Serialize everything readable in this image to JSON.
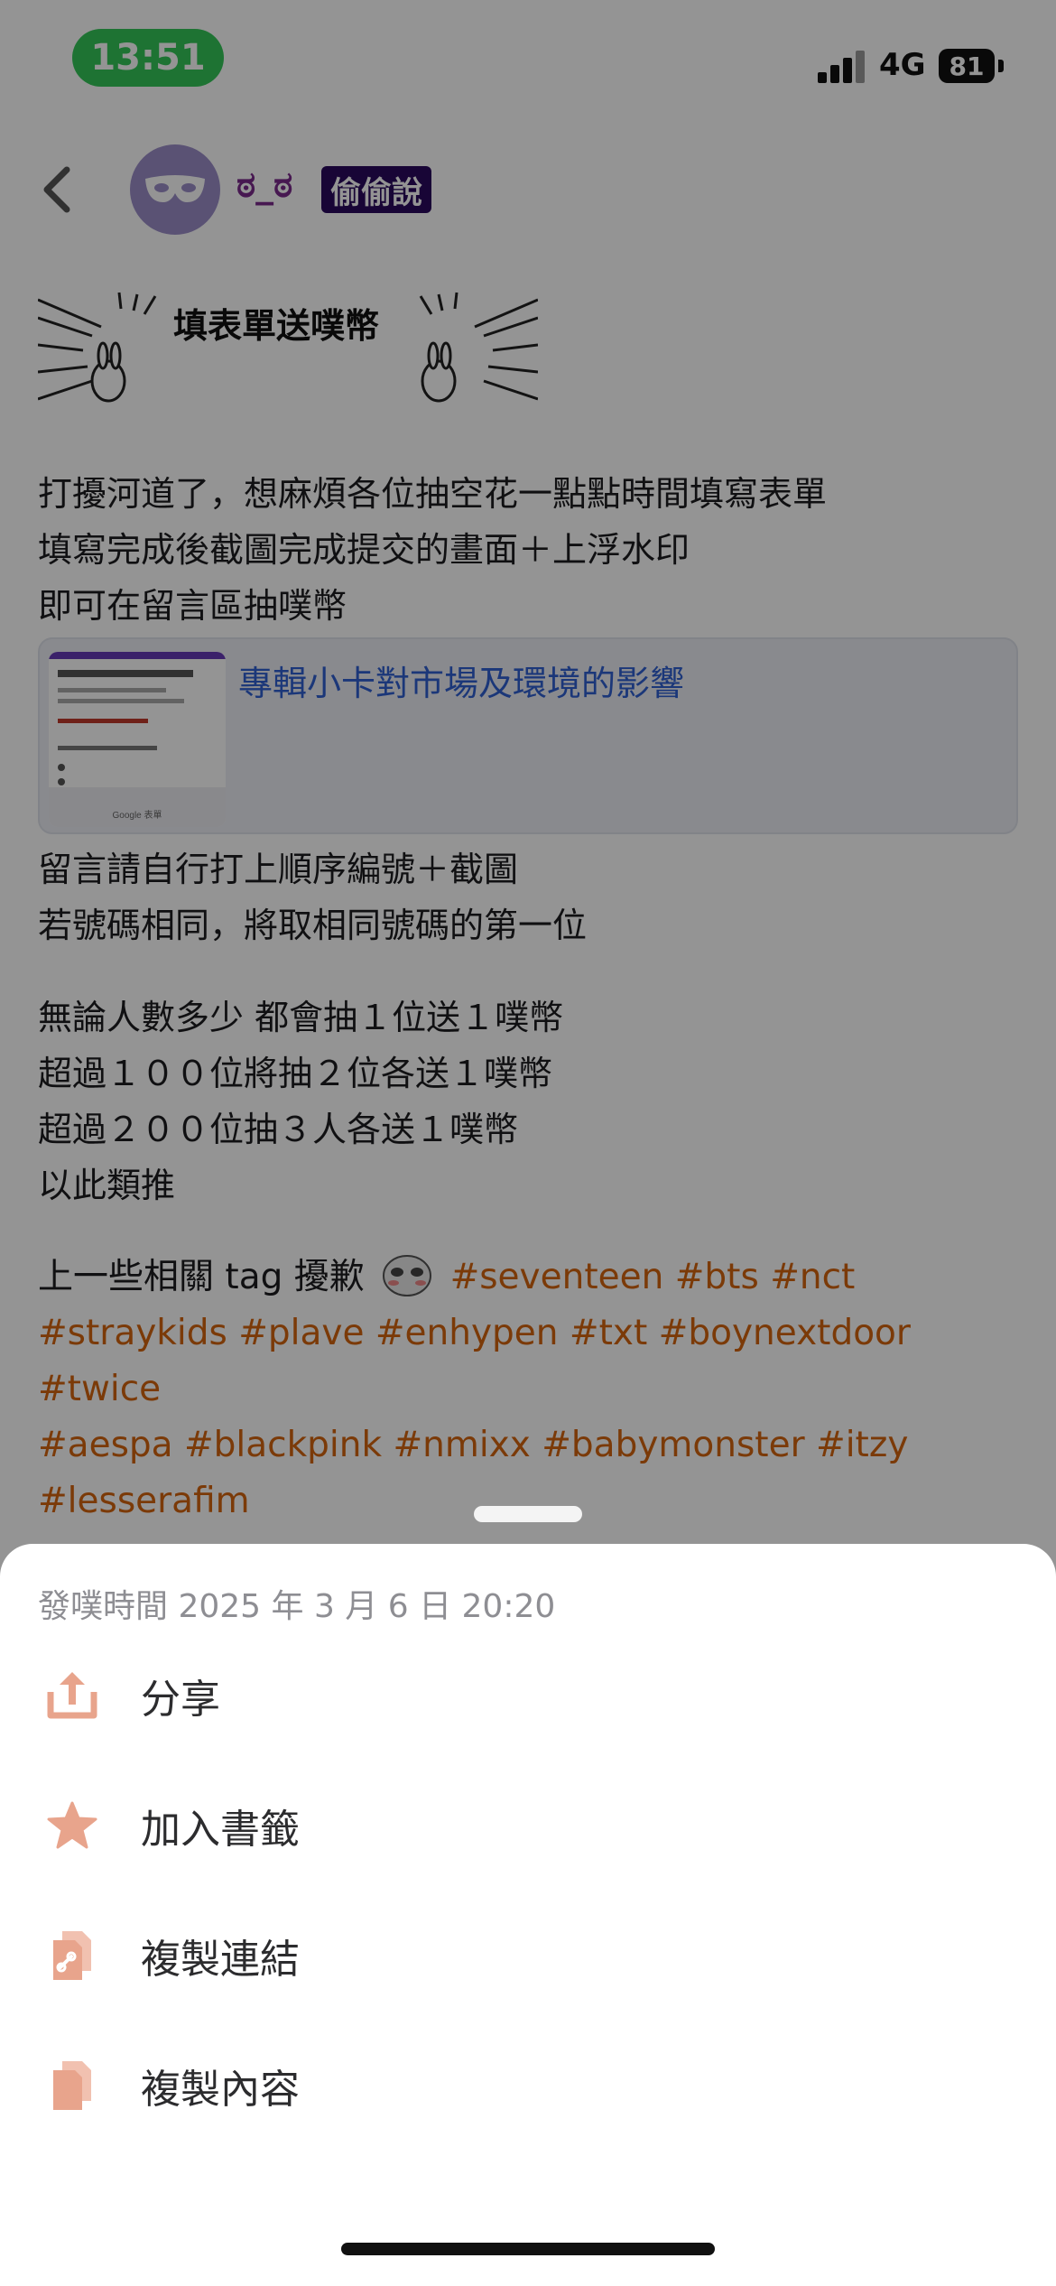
{
  "status_bar": {
    "time": "13:51",
    "network": "4G",
    "battery": "81"
  },
  "header": {
    "username": "ಠ_ಠ",
    "badge": "偷偷說"
  },
  "post": {
    "banner_title": "填表單送噗幣",
    "paragraph1": [
      "打擾河道了，想麻煩各位抽空花一點點時間填寫表單",
      "填寫完成後截圖完成提交的畫面＋上浮水印",
      "即可在留言區抽噗幣"
    ],
    "link_card": {
      "title": "專輯小卡對市場及環境的影響",
      "thumb_brand": "Google 表單"
    },
    "paragraph2": [
      "留言請自行打上順序編號＋截圖",
      "若號碼相同，將取相同號碼的第一位"
    ],
    "paragraph3": [
      "無論人數多少 都會抽１位送１噗幣",
      "超過１００位將抽２位各送１噗幣",
      "超過２００位抽３人各送１噗幣",
      "以此類推"
    ],
    "tags_intro": "上一些相關 tag 擾歉",
    "hashtags": [
      "#seventeen",
      "#bts",
      "#nct",
      "#straykids",
      "#plave",
      "#enhypen",
      "#txt",
      "#boynextdoor",
      "#twice",
      "#aespa",
      "#blackpink",
      "#nmixx",
      "#babymonster",
      "#itzy",
      "#lesserafim"
    ]
  },
  "sheet": {
    "meta": "發噗時間 2025 年 3 月 6 日 20:20",
    "items": [
      {
        "label": "分享",
        "icon": "share-icon"
      },
      {
        "label": "加入書籤",
        "icon": "star-icon"
      },
      {
        "label": "複製連結",
        "icon": "copy-link-icon"
      },
      {
        "label": "複製內容",
        "icon": "copy-content-icon"
      }
    ]
  },
  "colors": {
    "accent": "#d4650f",
    "menu_icon": "#e8a48c",
    "link": "#2f5fd0",
    "badge_bg": "#2a0a5e"
  }
}
